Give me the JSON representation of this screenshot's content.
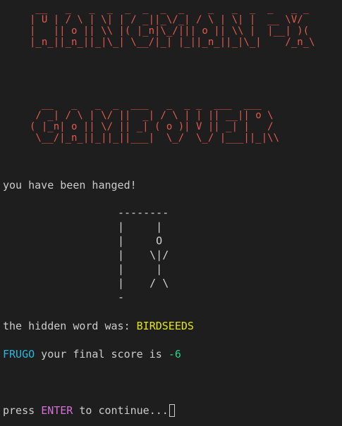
{
  "banner": {
    "hangman_art": " __   _   _  _  _  _  _  _    _   _  _  _   _ _ \n| U | / \\ | \\| | / _||_\\/_| / \\ | \\| |  __ \\V/\n|   || o || \\\\ |( |_n|\\_/||| o || \\\\ |  |__| )(\n|_n_||_n_||_|\\_| \\__/|_| |_||_n_||_|\\_|    /_n_\\",
    "gameover_art": "  __   _   _  _  ___   _  _ _  ___  ___\n / _| / \\ | \\/ ||  _| / \\ | | || __|| o \\\n( |_n| o || \\/ || _| ( o )| V || _| |   /\n \\__/|_n_||_||_||___|  \\_/  \\_/ |___||_|\\\\"
  },
  "lost_message": "you have been hanged!",
  "gallows_art": "--------\n|     |\n|     O\n|    \\|/\n|     |\n|    / \\\n-",
  "hidden_word": {
    "label": "the hidden word was: ",
    "word": "BIRDSEEDS"
  },
  "score": {
    "player": "FRUGO",
    "text": " your final score is ",
    "value": "-6"
  },
  "prompt": {
    "before": "press ",
    "key": "ENTER",
    "after": " to continue..."
  }
}
